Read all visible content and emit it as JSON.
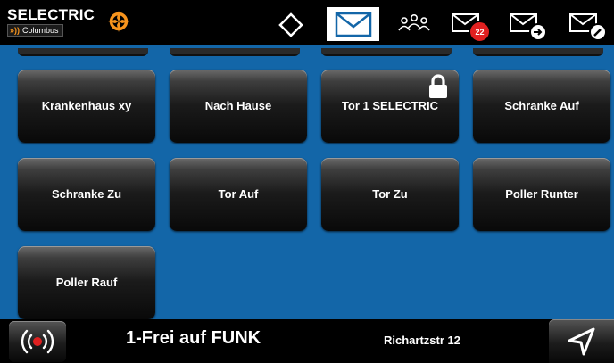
{
  "header": {
    "brand_name": "SELECTRIC",
    "brand_tag": "»))",
    "brand_sub": "Columbus",
    "unread_badge": "22",
    "icons": [
      "compass-logo-icon",
      "diamond-icon",
      "mail-icon",
      "group-icon",
      "mail-inbox-icon",
      "mail-send-icon",
      "mail-edit-icon"
    ]
  },
  "tiles": [
    {
      "label": "Krankenhaus xy"
    },
    {
      "label": "Nach Hause"
    },
    {
      "label": "Tor 1 SELECTRIC"
    },
    {
      "label": "Schranke Auf"
    },
    {
      "label": "Schranke Zu"
    },
    {
      "label": "Tor Auf"
    },
    {
      "label": "Tor Zu"
    },
    {
      "label": "Poller Runter"
    },
    {
      "label": "Poller Rauf"
    }
  ],
  "footer": {
    "channel": "1-Frei auf FUNK",
    "location": "Richartzstr 12",
    "icons": [
      "radio-signal-icon",
      "send-arrow-icon"
    ]
  },
  "colors": {
    "grid_background": "#1366a8",
    "brand_accent": "#f7941d",
    "badge": "#e02020"
  }
}
